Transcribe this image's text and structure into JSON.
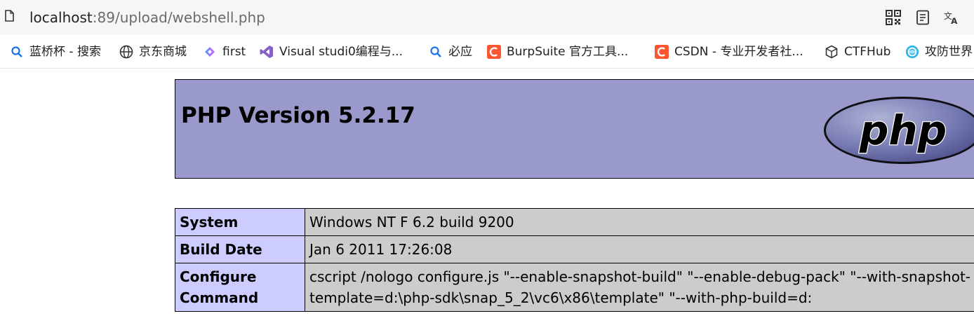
{
  "browser": {
    "url_host": "localhost",
    "url_rest": ":89/upload/webshell.php",
    "icons": [
      "page-icon",
      "qr-code-icon",
      "reader-mode-icon",
      "translate-icon"
    ]
  },
  "bookmarks": [
    {
      "icon": "search-icon",
      "label": "蓝桥杯 - 搜索"
    },
    {
      "icon": "globe-icon",
      "label": "京东商城"
    },
    {
      "icon": "diamond-icon",
      "label": "first"
    },
    {
      "icon": "visual-studio-icon",
      "label": "Visual studi0编程与..."
    },
    {
      "icon": "search-icon",
      "label": "必应"
    },
    {
      "icon": "csdn-icon",
      "label": "BurpSuite 官方工具..."
    },
    {
      "icon": "csdn-icon",
      "label": "CSDN - 专业开发者社..."
    },
    {
      "icon": "cube-icon",
      "label": "CTFHub"
    },
    {
      "icon": "globe-color-icon",
      "label": "攻防世界"
    }
  ],
  "colors": {
    "header_bg": "#9999cc",
    "label_bg": "#ccccff",
    "value_bg": "#cccccc",
    "csdn": "#fc5531"
  },
  "php": {
    "title": "PHP Version 5.2.17",
    "logo_text": "php",
    "rows": [
      {
        "label": "System",
        "value": "Windows NT F 6.2 build 9200"
      },
      {
        "label": "Build Date",
        "value": "Jan 6 2011 17:26:08"
      },
      {
        "label": "Configure Command",
        "value": "cscript /nologo configure.js \"--enable-snapshot-build\" \"--enable-debug-pack\" \"--with-snapshot-template=d:\\php-sdk\\snap_5_2\\vc6\\x86\\template\" \"--with-php-build=d:"
      }
    ]
  }
}
